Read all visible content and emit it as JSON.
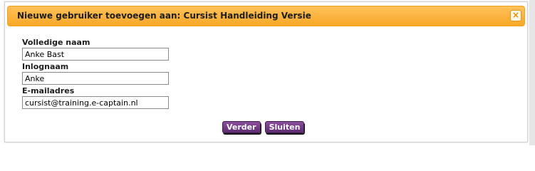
{
  "dialog": {
    "title": "Nieuwe gebruiker toevoegen aan: Cursist Handleiding Versie",
    "close_glyph": "×"
  },
  "form": {
    "fields": [
      {
        "label": "Volledige naam",
        "value": "Anke Bast"
      },
      {
        "label": "Inlognaam",
        "value": "Anke"
      },
      {
        "label": "E-mailadres",
        "value": "cursist@training.e-captain.nl"
      }
    ]
  },
  "buttons": {
    "next_label": "Verder",
    "close_label": "Sluiten"
  },
  "colors": {
    "titlebar": "#f8a828",
    "button": "#6b347f"
  }
}
